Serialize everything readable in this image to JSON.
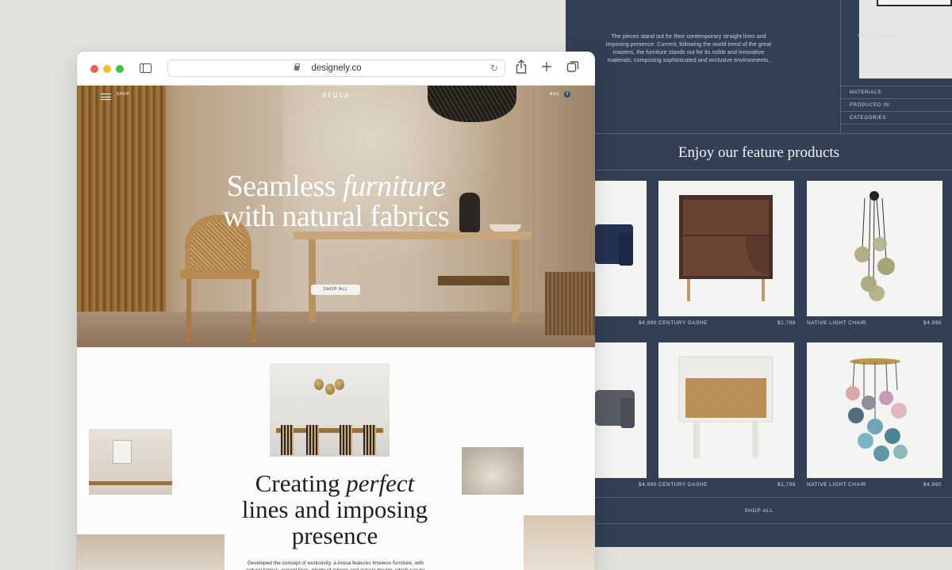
{
  "dark_page": {
    "intro_text": "The pieces stand out for their contemporary straight lines and imposing presence. Current, following the world trend of the great masters, the furniture stands out for its noble and innovative materials, composing sophisticated and exclusive environments.",
    "lookbook_label": "SEE LOOKBOOK",
    "meta": {
      "materials": "MATERIALS:",
      "produced_in": "PRODUCED IN:",
      "categories": "CATEGORIES:"
    },
    "feature_title": "Enjoy our feature products",
    "row1": {
      "price_left": "$4,990",
      "name_mid": "CENTURY DASHE",
      "price_mid": "$1,799",
      "name_right": "NATIVE LIGHT CHAIR",
      "price_right": "$4,990"
    },
    "row2": {
      "price_left": "$4,990",
      "name_mid": "CENTURY DASHE",
      "price_mid": "$1,799",
      "name_right": "NATIVE LIGHT CHAIR",
      "price_right": "$4,990"
    },
    "shop_all": "SHOP ALL",
    "colors": {
      "background": "#333f55",
      "line": "#56627a"
    }
  },
  "browser": {
    "url": "designely.co",
    "window_controls": [
      "close",
      "minimize",
      "zoom"
    ],
    "toolbar_icons": [
      "sidebar-icon",
      "share-icon",
      "new-tab-icon",
      "tabs-overview-icon"
    ],
    "nav": {
      "shop": "SHOP",
      "logo": "arusa",
      "bag": "BAG",
      "bag_count": "0"
    },
    "hero": {
      "title_line1_start": "Seamless ",
      "title_line1_em": "furniture",
      "title_line2": "with natural fabrics",
      "cta": "SHOP ALL"
    },
    "section": {
      "title_start": "Creating ",
      "title_em": "perfect",
      "title_rest": "lines and imposing presence",
      "body": "Developed the concept of exclusivity, a Arusa features timeless furniture, with natural fabrics, curved lines, plenty of mirrors and classic design, which can be"
    }
  }
}
